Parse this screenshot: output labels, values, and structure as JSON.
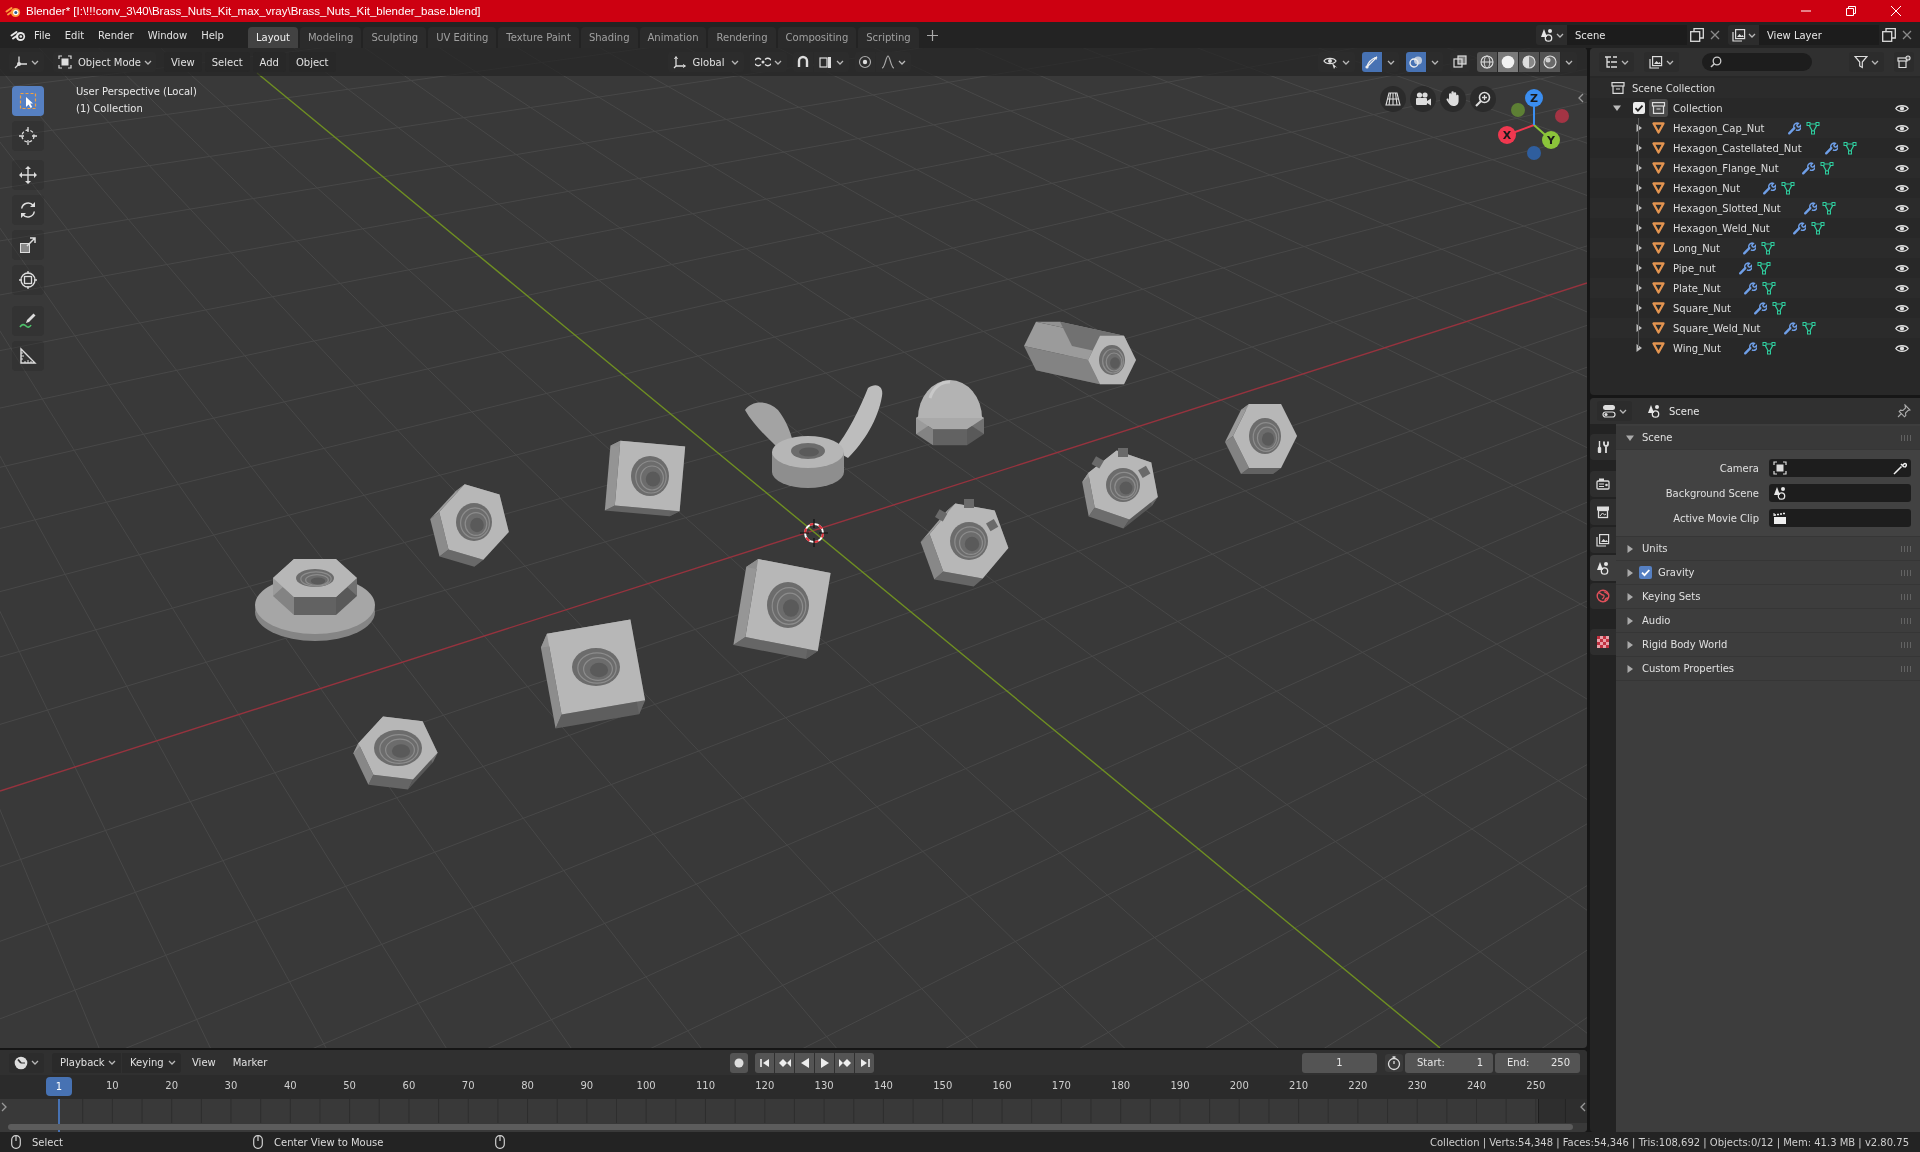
{
  "title_bar": {
    "title": "Blender* [I:\\!!!conv_3\\40\\Brass_Nuts_Kit_max_vray\\Brass_Nuts_Kit_blender_base.blend]"
  },
  "menu_bar": {
    "items": [
      "File",
      "Edit",
      "Render",
      "Window",
      "Help"
    ]
  },
  "workspace_tabs": [
    {
      "label": "Layout",
      "selected": true
    },
    {
      "label": "Modeling",
      "selected": false
    },
    {
      "label": "Sculpting",
      "selected": false
    },
    {
      "label": "UV Editing",
      "selected": false
    },
    {
      "label": "Texture Paint",
      "selected": false
    },
    {
      "label": "Shading",
      "selected": false
    },
    {
      "label": "Animation",
      "selected": false
    },
    {
      "label": "Rendering",
      "selected": false
    },
    {
      "label": "Compositing",
      "selected": false
    },
    {
      "label": "Scripting",
      "selected": false
    }
  ],
  "scene_selector": {
    "value": "Scene"
  },
  "view_layer_selector": {
    "value": "View Layer"
  },
  "viewport": {
    "header": {
      "mode": "Object Mode",
      "menus": [
        "View",
        "Select",
        "Add",
        "Object"
      ],
      "orientation": "Global",
      "gizmos_on": true,
      "overlays_on": true,
      "xray_on": false,
      "shading_modes": [
        {
          "kind": "wireframe",
          "selected": false
        },
        {
          "kind": "solid",
          "selected": true
        },
        {
          "kind": "material",
          "selected": false
        },
        {
          "kind": "rendered",
          "selected": false
        }
      ]
    },
    "view_name": "User Perspective (Local)",
    "collection_label": "(1) Collection",
    "tools": [
      {
        "kind": "select_box",
        "selected": true
      },
      {
        "kind": "cursor",
        "selected": false
      },
      {
        "kind": "move",
        "selected": false
      },
      {
        "kind": "rotate",
        "selected": false
      },
      {
        "kind": "scale",
        "selected": false
      },
      {
        "kind": "transform",
        "selected": false
      },
      {
        "kind": "annotate",
        "selected": false
      },
      {
        "kind": "measure",
        "selected": false
      }
    ],
    "axis_labels": [
      "X",
      "Y",
      "Z"
    ]
  },
  "outliner": {
    "root": "Scene Collection",
    "collection": {
      "label": "Collection",
      "checked": true,
      "expanded": true,
      "visible": true,
      "children": [
        {
          "label": "Hexagon_Cap_Nut",
          "expanded": false,
          "visible": true
        },
        {
          "label": "Hexagon_Castellated_Nut",
          "expanded": false,
          "visible": true
        },
        {
          "label": "Hexagon_Flange_Nut",
          "expanded": false,
          "visible": true
        },
        {
          "label": "Hexagon_Nut",
          "expanded": false,
          "visible": true
        },
        {
          "label": "Hexagon_Slotted_Nut",
          "expanded": false,
          "visible": true
        },
        {
          "label": "Hexagon_Weld_Nut",
          "expanded": false,
          "visible": true
        },
        {
          "label": "Long_Nut",
          "expanded": false,
          "visible": true
        },
        {
          "label": "Pipe_nut",
          "expanded": false,
          "visible": true
        },
        {
          "label": "Plate_Nut",
          "expanded": false,
          "visible": true
        },
        {
          "label": "Square_Nut",
          "expanded": false,
          "visible": true
        },
        {
          "label": "Square_Weld_Nut",
          "expanded": false,
          "visible": true
        },
        {
          "label": "Wing_Nut",
          "expanded": false,
          "visible": true
        }
      ]
    }
  },
  "properties": {
    "context": "Scene",
    "tabs": [
      {
        "kind": "tool",
        "selected": false
      },
      {
        "kind": "render",
        "selected": false
      },
      {
        "kind": "output",
        "selected": false
      },
      {
        "kind": "view_layer",
        "selected": false
      },
      {
        "kind": "scene",
        "selected": true
      },
      {
        "kind": "world",
        "selected": false
      },
      {
        "kind": "texture",
        "selected": false
      }
    ],
    "panels": [
      {
        "title": "Scene",
        "kind": "plain",
        "expanded": true,
        "fields": [
          {
            "label": "Camera",
            "kind": "camera"
          },
          {
            "label": "Background Scene",
            "kind": "scene"
          },
          {
            "label": "Active Movie Clip",
            "kind": "clip"
          }
        ]
      },
      {
        "title": "Units",
        "kind": "plain",
        "expanded": false
      },
      {
        "title": "Gravity",
        "kind": "checkbox",
        "checked": true,
        "expanded": false
      },
      {
        "title": "Keying Sets",
        "kind": "plain",
        "expanded": false
      },
      {
        "title": "Audio",
        "kind": "plain",
        "expanded": false
      },
      {
        "title": "Rigid Body World",
        "kind": "plain",
        "expanded": false
      },
      {
        "title": "Custom Properties",
        "kind": "plain",
        "expanded": false
      }
    ]
  },
  "timeline": {
    "menus": [
      {
        "label": "Playback",
        "dropdown": true
      },
      {
        "label": "Keying",
        "dropdown": true
      },
      {
        "label": "View",
        "dropdown": false
      },
      {
        "label": "Marker",
        "dropdown": false
      }
    ],
    "current_frame": "1",
    "start_label": "Start:",
    "start": "1",
    "end_label": "End:",
    "end": "250",
    "playhead": "1",
    "ruler": [
      "10",
      "20",
      "30",
      "40",
      "50",
      "60",
      "70",
      "80",
      "90",
      "100",
      "110",
      "120",
      "130",
      "140",
      "150",
      "160",
      "170",
      "180",
      "190",
      "200",
      "210",
      "220",
      "230",
      "240",
      "250"
    ]
  },
  "status_bar": {
    "hints": [
      "Select",
      "Center View to Mouse"
    ],
    "stats": "Collection | Verts:54,348 | Faces:54,346 | Tris:108,692 | Objects:0/12 | Mem: 41.3 MB | v2.80.75"
  }
}
